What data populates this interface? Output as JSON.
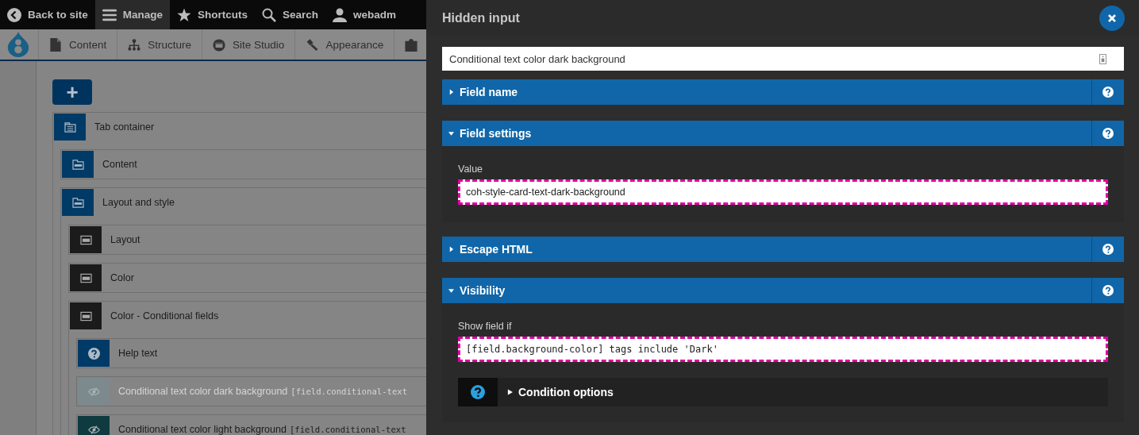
{
  "toolbar": {
    "items": [
      {
        "label": "Back to site",
        "selected": false
      },
      {
        "label": "Manage",
        "selected": true
      },
      {
        "label": "Shortcuts",
        "selected": false
      },
      {
        "label": "Search",
        "selected": false
      },
      {
        "label": "webadm",
        "selected": false
      }
    ]
  },
  "admin_menu": {
    "items": [
      {
        "label": "Content"
      },
      {
        "label": "Structure"
      },
      {
        "label": "Site Studio"
      },
      {
        "label": "Appearance"
      }
    ]
  },
  "builder": {
    "add_button": "+",
    "tree": [
      {
        "label": "Tab container",
        "kind": "tabs",
        "color": "#003a66",
        "disabled": false,
        "children": [
          {
            "label": "Content",
            "kind": "tab",
            "color": "#003a66",
            "disabled": false
          },
          {
            "label": "Layout and style",
            "kind": "tab",
            "color": "#003a66",
            "disabled": false,
            "children": [
              {
                "label": "Layout",
                "kind": "section",
                "color": "#1b1b1b",
                "disabled": false
              },
              {
                "label": "Color",
                "kind": "section",
                "color": "#1b1b1b",
                "disabled": false
              },
              {
                "label": "Color - Conditional fields",
                "kind": "section",
                "color": "#1b1b1b",
                "disabled": false,
                "children": [
                  {
                    "label": "Help text",
                    "kind": "help",
                    "color": "#003a66",
                    "disabled": false
                  },
                  {
                    "label": "Conditional text color dark background",
                    "token": "[field.conditional-text",
                    "kind": "hidden",
                    "color": "#7d8a8d",
                    "disabled": true
                  },
                  {
                    "label": "Conditional text color light background",
                    "token": "[field.conditional-text",
                    "kind": "hidden",
                    "color": "#0e3a40",
                    "disabled": false
                  }
                ]
              }
            ]
          }
        ]
      }
    ]
  },
  "modal": {
    "title": "Hidden input",
    "label_field": {
      "value": "Conditional text color dark background"
    },
    "sections": [
      {
        "title": "Field name",
        "expanded": false
      },
      {
        "title": "Field settings",
        "expanded": true,
        "fields": [
          {
            "label": "Value",
            "value": "coh-style-card-text-dark-background",
            "kind": "text"
          }
        ]
      },
      {
        "title": "Escape HTML",
        "expanded": false
      },
      {
        "title": "Visibility",
        "expanded": true,
        "fields": [
          {
            "label": "Show field if",
            "value": "[field.background-color] tags include 'Dark'",
            "kind": "code"
          }
        ],
        "condition_options": {
          "label": "Condition options",
          "expanded": false
        }
      }
    ]
  }
}
